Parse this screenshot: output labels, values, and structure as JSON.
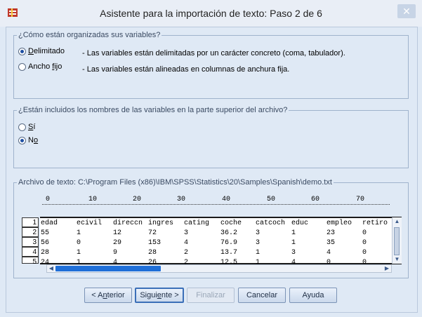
{
  "window": {
    "title": "Asistente para la importación de texto: Paso 2 de 6",
    "close_glyph": "✕"
  },
  "organization": {
    "legend": "¿Cómo están organizadas sus variables?",
    "options": [
      {
        "label_pre": "",
        "label_ul": "D",
        "label_post": "elimitado",
        "checked": true,
        "desc": "- Las variables están delimitadas por un carácter concreto (coma, tabulador)."
      },
      {
        "label_pre": "Ancho ",
        "label_ul": "f",
        "label_post": "ijo",
        "checked": false,
        "desc": "- Las variables están alineadas en columnas de anchura fija."
      }
    ]
  },
  "names": {
    "legend": "¿Están incluidos los nombres de las variables en la parte superior del archivo?",
    "yes_pre": "",
    "yes_ul": "S",
    "yes_post": "í",
    "no_pre": "N",
    "no_ul": "o",
    "no_post": "",
    "selected": "no"
  },
  "file": {
    "legend": "Archivo de texto:  C:\\Program Files (x86)\\IBM\\SPSS\\Statistics\\20\\Samples\\Spanish\\demo.txt",
    "ruler_ticks": [
      "0",
      "10",
      "20",
      "30",
      "40",
      "50",
      "60",
      "70"
    ],
    "row_numbers": [
      "1",
      "2",
      "3",
      "4",
      "5"
    ],
    "rows": [
      [
        "edad",
        "ecivil",
        "direccn",
        "ingres",
        "cating",
        "coche",
        "catcoch",
        "educ",
        "empleo",
        "retiro"
      ],
      [
        "55",
        "1",
        "12",
        "72",
        "3",
        "36.2",
        "3",
        "1",
        "23",
        "0"
      ],
      [
        "56",
        "0",
        "29",
        "153",
        "4",
        "76.9",
        "3",
        "1",
        "35",
        "0"
      ],
      [
        "28",
        "1",
        "9",
        "28",
        "2",
        "13.7",
        "1",
        "3",
        "4",
        "0"
      ],
      [
        "24",
        "1",
        "4",
        "26",
        "2",
        "12.5",
        "1",
        "4",
        "0",
        "0"
      ]
    ]
  },
  "buttons": {
    "back_pre": "< A",
    "back_ul": "n",
    "back_post": "terior",
    "next_pre": "Sigui",
    "next_ul": "e",
    "next_post": "nte >",
    "finish": "Finalizar",
    "cancel": "Cancelar",
    "help": "Ayuda"
  }
}
